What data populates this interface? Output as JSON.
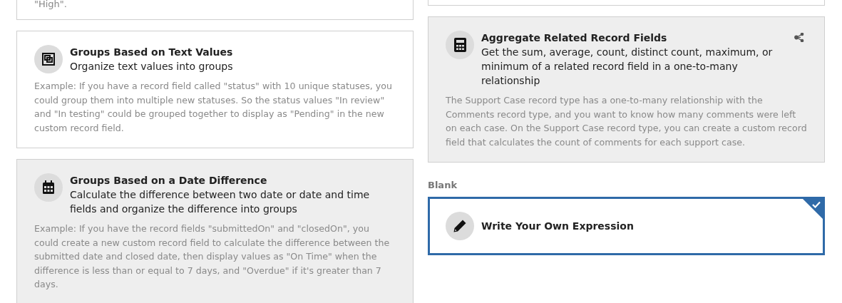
{
  "columns": [
    {
      "cards": [
        {
          "kind": "partial",
          "selected": false,
          "shaded": false,
          "text": "\"High\"."
        },
        {
          "kind": "option",
          "selected": false,
          "shaded": false,
          "title": "Groups Based on Text Values",
          "subtitle": "Organize text values into groups",
          "example": "Example: If you have a record field called \"status\" with 10 unique statuses, you could group them into multiple new statuses. So the status values \"In review\" and \"In testing\" could be grouped together to display as \"Pending\" in the new custom record field."
        },
        {
          "kind": "option",
          "selected": false,
          "shaded": true,
          "title": "Groups Based on a Date Difference",
          "subtitle": "Calculate the difference between two date or date and time fields and organize the difference into groups",
          "example": "Example: If you have the record fields \"submittedOn\" and \"closedOn\", you could create a new custom record field to calculate the difference between the submitted date and closed date, then display values as \"On Time\" when the difference is less than or equal to 7 days, and \"Overdue\" if it's greater than 7 days."
        }
      ]
    },
    {
      "cards": [
        {
          "kind": "partial",
          "selected": false,
          "shaded": false
        },
        {
          "kind": "option",
          "related": true,
          "selected": false,
          "shaded": true,
          "title": "Aggregate Related Record Fields",
          "subtitle": "Get the sum, average, count, distinct count, maximum, or minimum of a related record field in a one-to-many relationship",
          "example": "The Support Case record type has a one-to-many relationship with the Comments record type, and you want to know how many comments were left on each case. On the Support Case record type, you can create a custom record field that calculates the count of comments for each support case."
        },
        {
          "kind": "heading",
          "text": "Blank"
        },
        {
          "kind": "option",
          "selected": true,
          "shaded": false,
          "title": "Write Your Own Expression"
        }
      ]
    }
  ]
}
